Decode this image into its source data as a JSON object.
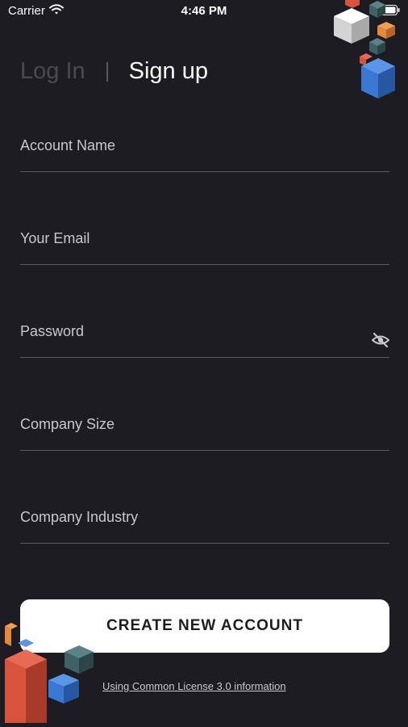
{
  "status_bar": {
    "carrier": "Carrier",
    "time": "4:46 PM"
  },
  "tabs": {
    "login": "Log In",
    "signup": "Sign up"
  },
  "fields": [
    {
      "label": "Account Name"
    },
    {
      "label": "Your Email"
    },
    {
      "label": "Password"
    },
    {
      "label": "Company Size"
    },
    {
      "label": "Company Industry"
    }
  ],
  "create_button": {
    "label": "CREATE NEW ACCOUNT"
  },
  "license": {
    "text": "Using Common License 3.0 information"
  },
  "colors": {
    "background": "#1c1c22",
    "cube_red": "#d9523c",
    "cube_blue": "#3a78d6",
    "cube_teal": "#3f6266",
    "cube_orange": "#e38a3a",
    "cube_white": "#e6e6e6"
  },
  "icons": {
    "password_toggle": "eye-slash-icon",
    "wifi": "wifi-icon",
    "battery": "battery-icon"
  }
}
